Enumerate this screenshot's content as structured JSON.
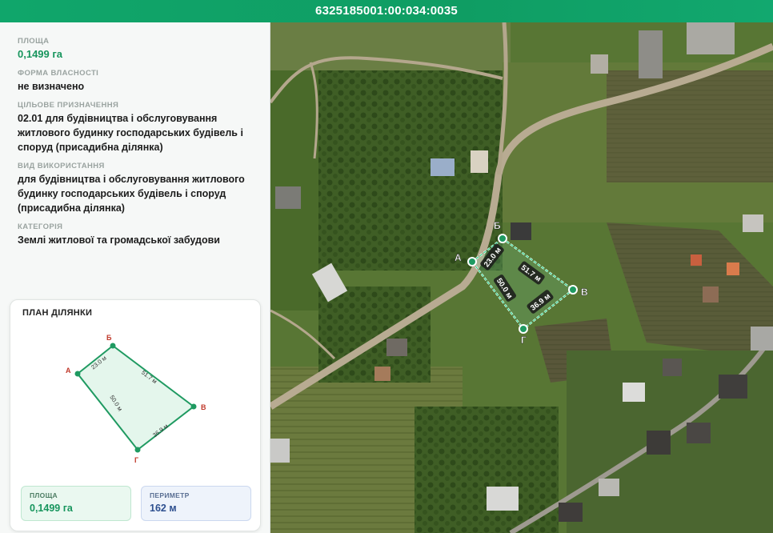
{
  "header": {
    "cadastral_number": "6325185001:00:034:0035"
  },
  "info": {
    "area_label": "ПЛОЩА",
    "area_value": "0,1499 га",
    "ownership_label": "ФОРМА ВЛАСНОСТІ",
    "ownership_value": "не визначено",
    "purpose_label": "ЦІЛЬОВЕ ПРИЗНАЧЕННЯ",
    "purpose_value": "02.01 для будівництва і обслуговування житлового будинку господарських будівель і споруд (присадибна ділянка)",
    "usage_label": "ВИД ВИКОРИСТАННЯ",
    "usage_value": "для будівництва і обслуговування житлового будинку господарських будівель і споруд (присадибна ділянка)",
    "category_label": "КАТЕГОРІЯ",
    "category_value": "Землі житлової та громадської забудови"
  },
  "plan": {
    "title": "ПЛАН ДІЛЯНКИ",
    "vertices": {
      "a": "А",
      "b": "Б",
      "v": "В",
      "g": "Г"
    },
    "edges": {
      "ab": "23.0 м",
      "bv": "51.7 м",
      "ag": "50.0 м",
      "gv": "36.9 м"
    },
    "area_label": "ПЛОЩА",
    "area_value": "0,1499 га",
    "perimeter_label": "ПЕРИМЕТР",
    "perimeter_value": "162 м"
  },
  "map": {
    "vertices": {
      "a": "А",
      "b": "Б",
      "v": "В",
      "g": "Г"
    },
    "edges": {
      "ab": "23.0 м",
      "bv": "51.7 м",
      "ag": "50.0 м",
      "gv": "36.9 м"
    }
  },
  "colors": {
    "accent": "#17955d",
    "vertex_label": "#c0392b",
    "header_bg": "#10a66b"
  }
}
